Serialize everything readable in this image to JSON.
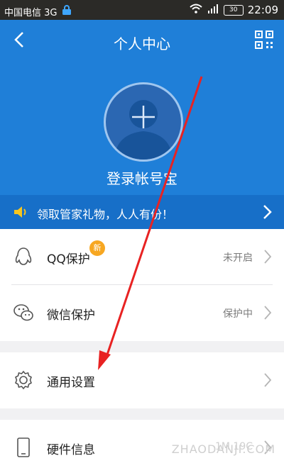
{
  "statusbar": {
    "carrier": "中国电信 3G",
    "time": "22:09",
    "battery": "30"
  },
  "header": {
    "title": "个人中心",
    "login_text": "登录帐号宝"
  },
  "promo": {
    "text": "领取管家礼物，人人有份！"
  },
  "section1": [
    {
      "label": "QQ保护",
      "status": "未开启",
      "badge": "新",
      "icon": "penguin-icon"
    },
    {
      "label": "微信保护",
      "status": "保护中",
      "icon": "wechat-icon"
    }
  ],
  "section2": [
    {
      "label": "通用设置",
      "icon": "gear-icon"
    }
  ],
  "section3": [
    {
      "label": "硬件信息",
      "status": "1M 19C",
      "icon": "phone-icon"
    }
  ],
  "watermark": "ZHAODANJI.COM",
  "colors": {
    "header": "#1f7fd8",
    "promo": "#176fc8",
    "badge": "#f7a722",
    "arrow": "#e82222"
  }
}
